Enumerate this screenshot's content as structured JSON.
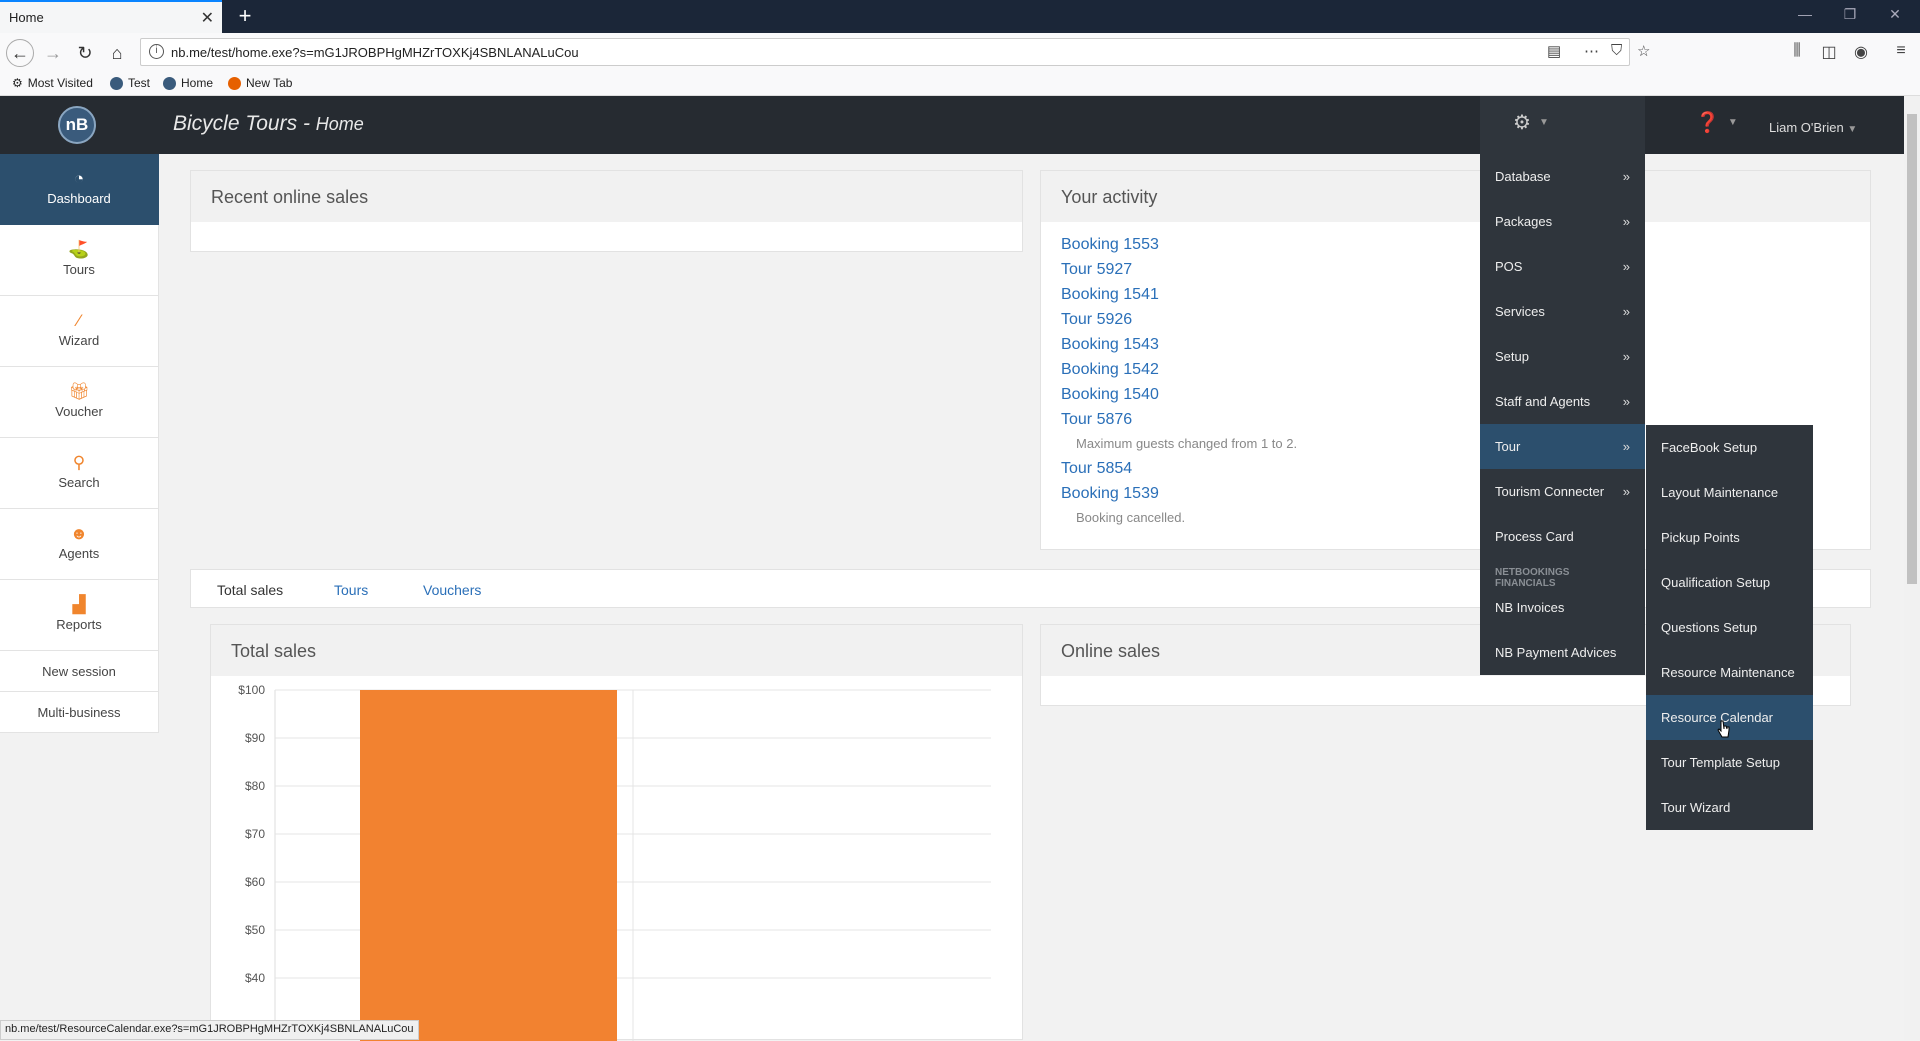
{
  "browser": {
    "tab_title": "Home",
    "url": "nb.me/test/home.exe?s=mG1JROBPHgMHZrTOXKj4SBNLANALuCou",
    "bookmarks": [
      "Most Visited",
      "Test",
      "Home",
      "New Tab"
    ],
    "status_url": "nb.me/test/ResourceCalendar.exe?s=mG1JROBPHgMHZrTOXKj4SBNLANALuCou"
  },
  "header": {
    "logo": "nB",
    "title": "Bicycle Tours",
    "separator": "-",
    "subtitle": "Home",
    "user": "Liam O'Brien"
  },
  "sidebar": {
    "items": [
      {
        "label": "Dashboard",
        "icon": "gauge-icon"
      },
      {
        "label": "Tours",
        "icon": "tours-icon"
      },
      {
        "label": "Wizard",
        "icon": "wand-icon"
      },
      {
        "label": "Voucher",
        "icon": "gift-icon"
      },
      {
        "label": "Search",
        "icon": "search-icon"
      },
      {
        "label": "Agents",
        "icon": "agent-icon"
      },
      {
        "label": "Reports",
        "icon": "chart-icon"
      }
    ],
    "links": [
      "New session",
      "Multi-business"
    ]
  },
  "recent_sales": {
    "title": "Recent online sales"
  },
  "activity": {
    "title": "Your activity",
    "entries": [
      {
        "link": "Booking 1553"
      },
      {
        "link": "Tour 5927"
      },
      {
        "link": "Booking 1541"
      },
      {
        "link": "Tour 5926"
      },
      {
        "link": "Booking 1543"
      },
      {
        "link": "Booking 1542"
      },
      {
        "link": "Booking 1540"
      },
      {
        "link": "Tour 5876",
        "note": "Maximum guests changed from 1 to 2."
      },
      {
        "link": "Tour 5854"
      },
      {
        "link": "Booking 1539",
        "note": "Booking cancelled."
      }
    ]
  },
  "tabs": [
    "Total sales",
    "Tours",
    "Vouchers"
  ],
  "total_sales_panel": {
    "title": "Total sales"
  },
  "online_sales_panel": {
    "title": "Online sales"
  },
  "chart_data": {
    "type": "bar",
    "title": "",
    "categories": [
      ""
    ],
    "values": [
      100
    ],
    "ylim": [
      30,
      100
    ],
    "yticks": [
      "$100",
      "$90",
      "$80",
      "$70",
      "$60",
      "$50",
      "$40"
    ],
    "color": "#f28230",
    "grid": true
  },
  "menu": {
    "items": [
      {
        "label": "Database",
        "arrow": "»"
      },
      {
        "label": "Packages",
        "arrow": "»"
      },
      {
        "label": "POS",
        "arrow": "»"
      },
      {
        "label": "Services",
        "arrow": "»"
      },
      {
        "label": "Setup",
        "arrow": "»"
      },
      {
        "label": "Staff and Agents",
        "arrow": "»"
      },
      {
        "label": "Tour",
        "arrow": "»",
        "active": true
      },
      {
        "label": "Tourism Connecter",
        "arrow": "»"
      },
      {
        "label": "Process Card",
        "arrow": ""
      }
    ],
    "section_header": "NETBOOKINGS FINANCIALS",
    "financial_items": [
      "NB Invoices",
      "NB Payment Advices"
    ],
    "submenu": [
      "FaceBook Setup",
      "Layout Maintenance",
      "Pickup Points",
      "Qualification Setup",
      "Questions Setup",
      "Resource Maintenance",
      "Resource Calendar",
      "Tour Template Setup",
      "Tour Wizard"
    ],
    "submenu_active": "Resource Calendar"
  }
}
